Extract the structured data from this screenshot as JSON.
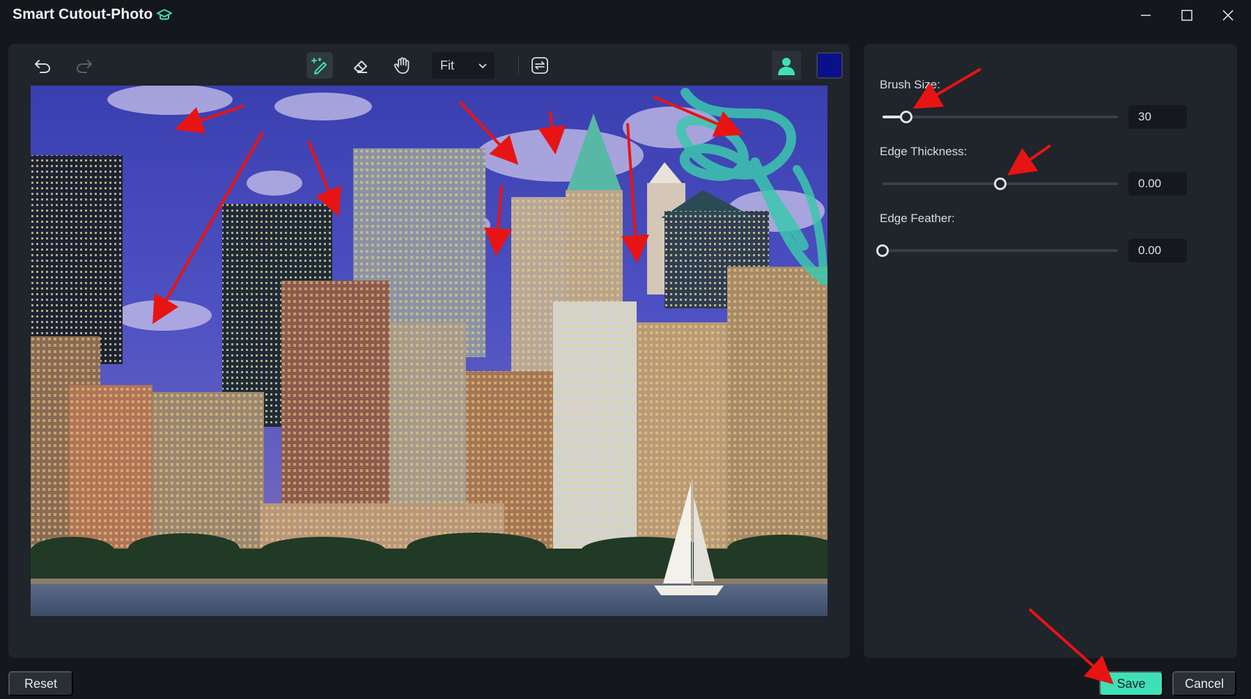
{
  "window": {
    "title": "Smart Cutout-Photo",
    "title_icon": "graduation-cap-icon",
    "controls": [
      "minimize-icon",
      "maximize-icon",
      "close-icon"
    ]
  },
  "toolbar": {
    "undo_icon": "undo-icon",
    "redo_icon": "redo-icon",
    "tools": [
      "smart-brush-icon",
      "eraser-icon",
      "hand-icon"
    ],
    "active_tool": "smart-brush-icon",
    "zoom": "Fit",
    "compare_icon": "swap-view-icon",
    "portrait_icon": "portrait-icon",
    "brush_color": "#0a0f8c"
  },
  "settings": {
    "brush_size": {
      "label": "Brush Size:",
      "value": "30",
      "fraction": 0.1
    },
    "edge_thickness": {
      "label": "Edge Thickness:",
      "value": "0.00",
      "fraction": 0.5
    },
    "edge_feather": {
      "label": "Edge Feather:",
      "value": "0.00",
      "fraction": 0.0
    }
  },
  "buttons": {
    "reset": "Reset",
    "save": "Save",
    "cancel": "Cancel"
  },
  "colors": {
    "accent": "#3fe0b8",
    "annotation_arrows": "#e81414",
    "brush_stroke": "#3cc7ae"
  }
}
